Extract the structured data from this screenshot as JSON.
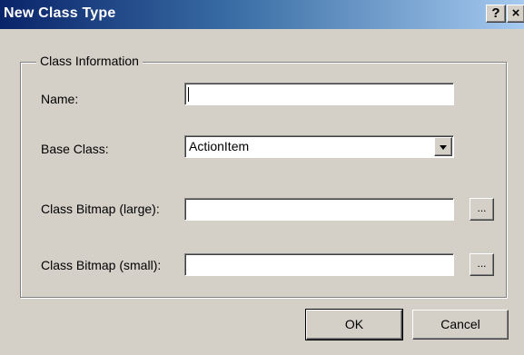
{
  "window": {
    "title": "New Class Type",
    "help_glyph": "?",
    "close_glyph": "×"
  },
  "group": {
    "legend": "Class Information"
  },
  "fields": {
    "name": {
      "label": "Name:",
      "value": ""
    },
    "base_class": {
      "label": "Base Class:",
      "value": "ActionItem"
    },
    "bitmap_large": {
      "label": "Class Bitmap (large):",
      "value": "",
      "browse": "..."
    },
    "bitmap_small": {
      "label": "Class Bitmap (small):",
      "value": "",
      "browse": "..."
    }
  },
  "buttons": {
    "ok": "OK",
    "cancel": "Cancel"
  },
  "colors": {
    "titlebar_start": "#0a246a",
    "titlebar_end": "#a6caf0",
    "face": "#d4d0c8"
  },
  "icons": {
    "dropdown": "chevron-down-icon",
    "help": "help-icon",
    "close": "close-icon"
  }
}
